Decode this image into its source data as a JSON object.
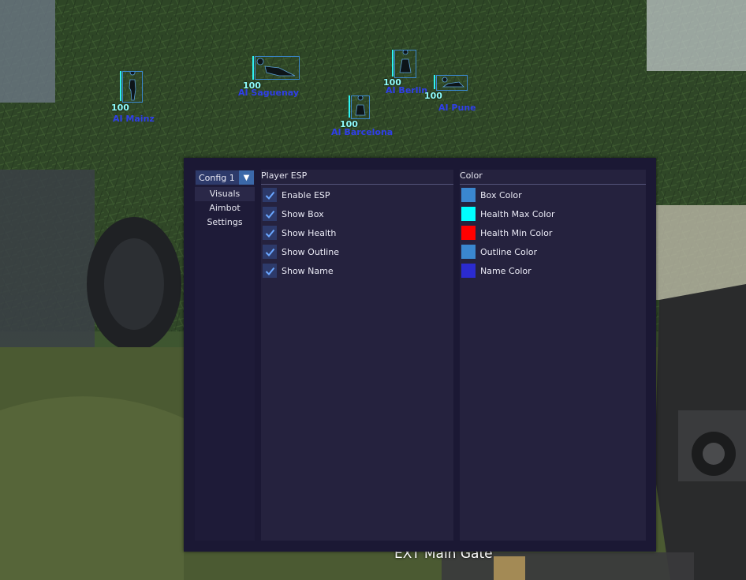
{
  "location": "EXT Main Gate",
  "esp_targets": [
    {
      "name": "AI Mainz",
      "health": "100"
    },
    {
      "name": "AI Saguenay",
      "health": "100"
    },
    {
      "name": "AI Barcelona",
      "health": "100"
    },
    {
      "name": "AI Berlin",
      "health": "100"
    },
    {
      "name": "AI Pune",
      "health": "100"
    }
  ],
  "menu": {
    "config": "Config 1",
    "nav": [
      "Visuals",
      "Aimbot",
      "Settings"
    ],
    "active_nav": "Visuals",
    "player_esp": {
      "title": "Player ESP",
      "options": [
        {
          "label": "Enable ESP",
          "checked": true
        },
        {
          "label": "Show Box",
          "checked": true
        },
        {
          "label": "Show Health",
          "checked": true
        },
        {
          "label": "Show Outline",
          "checked": true
        },
        {
          "label": "Show Name",
          "checked": true
        }
      ]
    },
    "color": {
      "title": "Color",
      "options": [
        {
          "label": "Box Color",
          "color": "#3a87cf"
        },
        {
          "label": "Health Max Color",
          "color": "#00ffff"
        },
        {
          "label": "Health Min Color",
          "color": "#ff0000"
        },
        {
          "label": "Outline Color",
          "color": "#3a87cf"
        },
        {
          "label": "Name Color",
          "color": "#2b2bd0"
        }
      ]
    }
  },
  "icons": {
    "dropdown": "triangle-down-icon",
    "checkbox": "checkmark-icon"
  }
}
